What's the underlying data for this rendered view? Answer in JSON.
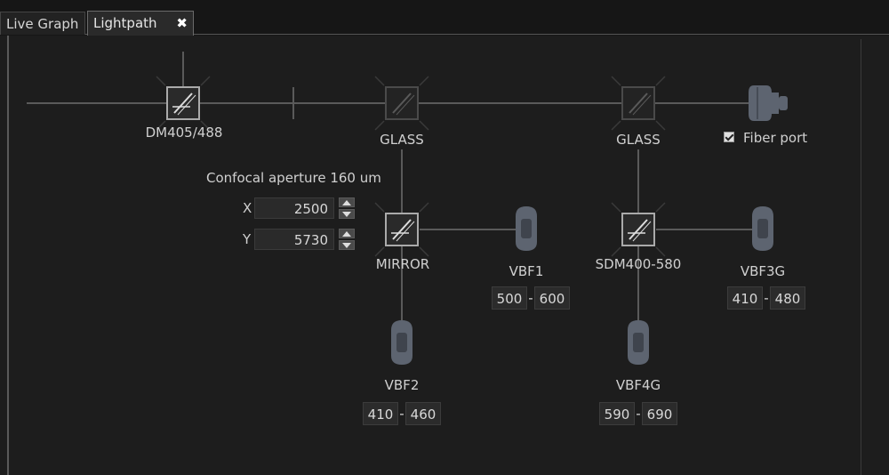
{
  "tabs": [
    {
      "label": "Live Graph",
      "active": false
    },
    {
      "label": "Lightpath",
      "active": true,
      "close_glyph": "✖"
    }
  ],
  "components": {
    "dm405": {
      "label": "DM405/488",
      "icon": "dichroic-mirror-icon"
    },
    "glass1": {
      "label": "GLASS",
      "icon": "glass-icon"
    },
    "glass2": {
      "label": "GLASS",
      "icon": "glass-icon"
    },
    "mirror": {
      "label": "MIRROR",
      "icon": "mirror-icon"
    },
    "sdm": {
      "label": "SDM400-580",
      "icon": "dichroic-mirror-icon"
    }
  },
  "fiber_port": {
    "label": "Fiber port",
    "checked": true
  },
  "confocal": {
    "title": "Confocal aperture 160 um",
    "x_label": "X",
    "x_value": "2500",
    "y_label": "Y",
    "y_value": "5730"
  },
  "detectors": {
    "vbf1": {
      "label": "VBF1",
      "min": "500",
      "max": "600"
    },
    "vbf2": {
      "label": "VBF2",
      "min": "410",
      "max": "460"
    },
    "vbf3g": {
      "label": "VBF3G",
      "min": "410",
      "max": "480"
    },
    "vbf4g": {
      "label": "VBF4G",
      "min": "590",
      "max": "690"
    }
  },
  "range_separator": "-",
  "colors": {
    "background": "#1d1d1d",
    "line": "#5a5a5a",
    "detector": "#5d6470",
    "text": "#d4d4d4"
  }
}
